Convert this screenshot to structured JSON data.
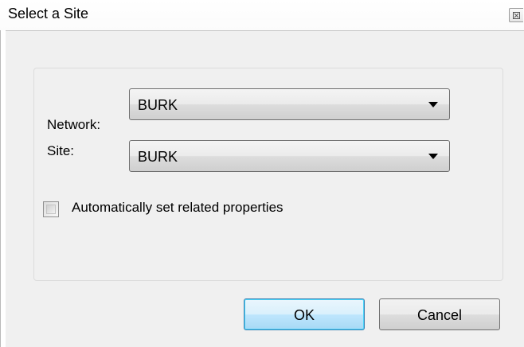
{
  "window": {
    "title": "Select a Site",
    "close_icon": "close-icon"
  },
  "form": {
    "network_label": "Network:",
    "network_value": "BURK",
    "site_label": "Site:",
    "site_value": "BURK",
    "auto_set_label": "Automatically set related properties",
    "auto_set_checked": false
  },
  "buttons": {
    "ok_label": "OK",
    "cancel_label": "Cancel"
  }
}
